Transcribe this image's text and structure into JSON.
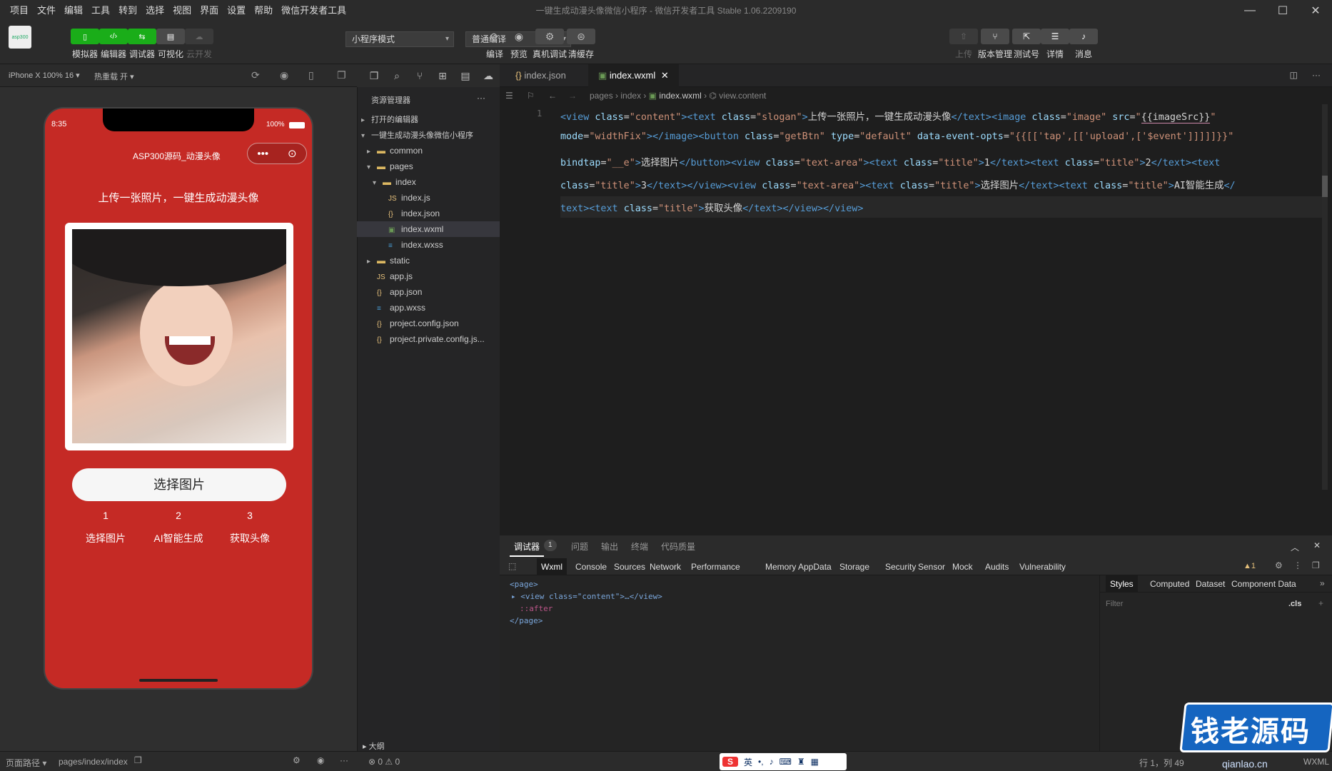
{
  "menus": [
    "项目",
    "文件",
    "编辑",
    "工具",
    "转到",
    "选择",
    "视图",
    "界面",
    "设置",
    "帮助",
    "微信开发者工具"
  ],
  "window_title": "一键生成动漫头像微信小程序 - 微信开发者工具 Stable 1.06.2209190",
  "toolbar": {
    "left": [
      {
        "label": "模拟器",
        "icon": "phone-icon"
      },
      {
        "label": "编辑器",
        "icon": "code-icon"
      },
      {
        "label": "调试器",
        "icon": "debug-icon"
      },
      {
        "label": "可视化",
        "icon": "layout-icon"
      },
      {
        "label": "云开发",
        "icon": "cloud-icon"
      }
    ],
    "mode_select": "小程序模式",
    "compile_select": "普通编译",
    "middle": [
      {
        "label": "编译",
        "icon": "refresh-icon"
      },
      {
        "label": "预览",
        "icon": "eye-icon"
      },
      {
        "label": "真机调试",
        "icon": "bug-icon"
      },
      {
        "label": "清缓存",
        "icon": "layers-icon"
      }
    ],
    "right": [
      {
        "label": "上传",
        "icon": "upload-icon"
      },
      {
        "label": "版本管理",
        "icon": "branch-icon"
      },
      {
        "label": "测试号",
        "icon": "share-icon"
      },
      {
        "label": "详情",
        "icon": "menu-icon"
      },
      {
        "label": "消息",
        "icon": "bell-icon"
      }
    ]
  },
  "simulator": {
    "device": "iPhone X 100% 16 ▾",
    "hotreload": "热重载 开 ▾",
    "time": "8:35",
    "battery": "100%",
    "nav_title": "ASP300源码_动漫头像",
    "slogan": "上传一张照片，一键生成动漫头像",
    "button": "选择图片",
    "steps": [
      {
        "num": "1",
        "label": "选择图片"
      },
      {
        "num": "2",
        "label": "AI智能生成"
      },
      {
        "num": "3",
        "label": "获取头像"
      }
    ]
  },
  "explorer": {
    "title": "资源管理器",
    "more": "···",
    "items": [
      {
        "label": "打开的编辑器",
        "indent": 0,
        "arrow": "▸",
        "icon": ""
      },
      {
        "label": "一键生成动漫头像微信小程序",
        "indent": 0,
        "arrow": "▾",
        "icon": ""
      },
      {
        "label": "common",
        "indent": 1,
        "arrow": "▸",
        "icon": "folder"
      },
      {
        "label": "pages",
        "indent": 1,
        "arrow": "▾",
        "icon": "folder"
      },
      {
        "label": "index",
        "indent": 2,
        "arrow": "▾",
        "icon": "folder"
      },
      {
        "label": "index.js",
        "indent": 3,
        "arrow": "",
        "icon": "js"
      },
      {
        "label": "index.json",
        "indent": 3,
        "arrow": "",
        "icon": "json"
      },
      {
        "label": "index.wxml",
        "indent": 3,
        "arrow": "",
        "icon": "wxml"
      },
      {
        "label": "index.wxss",
        "indent": 3,
        "arrow": "",
        "icon": "wxss"
      },
      {
        "label": "static",
        "indent": 1,
        "arrow": "▸",
        "icon": "folder"
      },
      {
        "label": "app.js",
        "indent": 1,
        "arrow": "",
        "icon": "js"
      },
      {
        "label": "app.json",
        "indent": 1,
        "arrow": "",
        "icon": "json"
      },
      {
        "label": "app.wxss",
        "indent": 1,
        "arrow": "",
        "icon": "wxss"
      },
      {
        "label": "project.config.json",
        "indent": 1,
        "arrow": "",
        "icon": "json"
      },
      {
        "label": "project.private.config.js...",
        "indent": 1,
        "arrow": "",
        "icon": "json"
      }
    ],
    "outline": "大纲",
    "errors": "⊗ 0 ⚠ 0"
  },
  "editor": {
    "tabs": [
      "index.json",
      "index.wxml"
    ],
    "breadcrumb": [
      "pages",
      "index",
      "index.wxml",
      "view.content"
    ],
    "line_number": "1"
  },
  "devtools": {
    "top_tabs": [
      "调试器",
      "1",
      "问题",
      "输出",
      "终端",
      "代码质量"
    ],
    "tabs": [
      "Wxml",
      "Console",
      "Sources",
      "Network",
      "Performance",
      "Memory",
      "AppData",
      "Storage",
      "Security",
      "Sensor",
      "Mock",
      "Audits",
      "Vulnerability"
    ],
    "warn": "▲1",
    "side_tabs": [
      "Styles",
      "Computed",
      "Dataset",
      "Component Data"
    ],
    "filter": "Filter",
    "cls": ".cls",
    "tree": [
      "<page>",
      "<view class=\"content\">…</view>",
      "::after",
      "</page>"
    ]
  },
  "status": {
    "path_label": "页面路径 ▾",
    "path": "pages/index/index",
    "right": "行 1，列 49",
    "lang": "WXML",
    "ime": "英"
  },
  "watermark": {
    "text": "钱老源码",
    "sub": "qianlao.cn"
  },
  "colors": {
    "accent": "#1aad19",
    "phone_bg": "#c52a25",
    "editor_bg": "#1e1e1e"
  }
}
